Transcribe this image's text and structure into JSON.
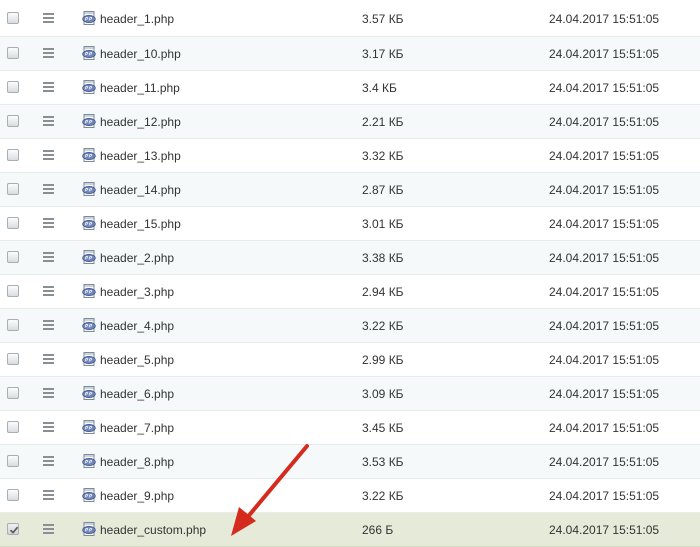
{
  "icons": {
    "checkbox": "checkbox-icon",
    "menu": "hamburger-menu-icon",
    "file": "php-file-icon"
  },
  "colors": {
    "row_alt": "#f5f9f9",
    "row_selected": "#e6ead9",
    "arrow": "#d42b1e"
  },
  "files": [
    {
      "name": "header_1.php",
      "size": "3.57 КБ",
      "modified": "24.04.2017 15:51:05",
      "selected": false
    },
    {
      "name": "header_10.php",
      "size": "3.17 КБ",
      "modified": "24.04.2017 15:51:05",
      "selected": false
    },
    {
      "name": "header_11.php",
      "size": "3.4 КБ",
      "modified": "24.04.2017 15:51:05",
      "selected": false
    },
    {
      "name": "header_12.php",
      "size": "2.21 КБ",
      "modified": "24.04.2017 15:51:05",
      "selected": false
    },
    {
      "name": "header_13.php",
      "size": "3.32 КБ",
      "modified": "24.04.2017 15:51:05",
      "selected": false
    },
    {
      "name": "header_14.php",
      "size": "2.87 КБ",
      "modified": "24.04.2017 15:51:05",
      "selected": false
    },
    {
      "name": "header_15.php",
      "size": "3.01 КБ",
      "modified": "24.04.2017 15:51:05",
      "selected": false
    },
    {
      "name": "header_2.php",
      "size": "3.38 КБ",
      "modified": "24.04.2017 15:51:05",
      "selected": false
    },
    {
      "name": "header_3.php",
      "size": "2.94 КБ",
      "modified": "24.04.2017 15:51:05",
      "selected": false
    },
    {
      "name": "header_4.php",
      "size": "3.22 КБ",
      "modified": "24.04.2017 15:51:05",
      "selected": false
    },
    {
      "name": "header_5.php",
      "size": "2.99 КБ",
      "modified": "24.04.2017 15:51:05",
      "selected": false
    },
    {
      "name": "header_6.php",
      "size": "3.09 КБ",
      "modified": "24.04.2017 15:51:05",
      "selected": false
    },
    {
      "name": "header_7.php",
      "size": "3.45 КБ",
      "modified": "24.04.2017 15:51:05",
      "selected": false
    },
    {
      "name": "header_8.php",
      "size": "3.53 КБ",
      "modified": "24.04.2017 15:51:05",
      "selected": false
    },
    {
      "name": "header_9.php",
      "size": "3.22 КБ",
      "modified": "24.04.2017 15:51:05",
      "selected": false
    },
    {
      "name": "header_custom.php",
      "size": "266 Б",
      "modified": "24.04.2017 15:51:05",
      "selected": true
    }
  ]
}
